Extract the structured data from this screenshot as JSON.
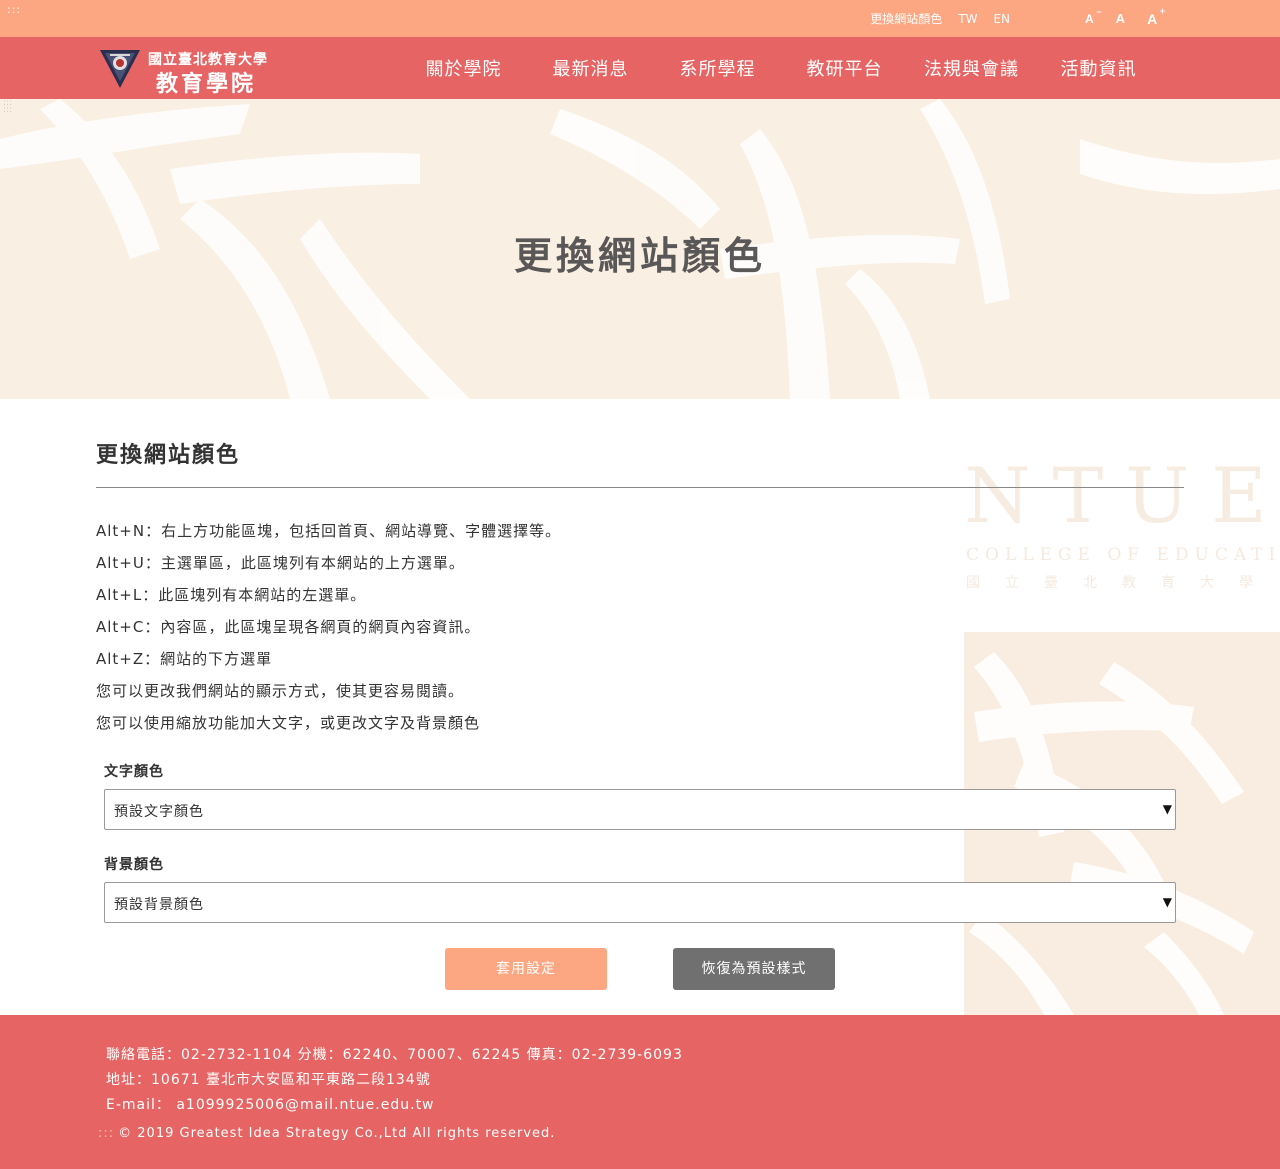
{
  "accesskey_top": ":::",
  "accesskey_side": ":::",
  "topbar": {
    "links": [
      "更換網站顏色",
      "TW",
      "EN"
    ],
    "font_sizes": [
      "A",
      "A",
      "A"
    ],
    "font_marks": [
      "−",
      "",
      "+"
    ]
  },
  "logo": {
    "line1": "國立臺北教育大學",
    "line2": "教育學院"
  },
  "nav": [
    "關於學院",
    "最新消息",
    "系所學程",
    "教研平台",
    "法規與會議",
    "活動資訊"
  ],
  "hero": {
    "title": "更換網站顏色"
  },
  "deco": {
    "big": "NTUE",
    "sub": "COLLEGE OF EDUCATION",
    "cn": "國立臺北教育大學"
  },
  "main": {
    "heading": "更換網站顏色",
    "descriptions": [
      "Alt+N：右上方功能區塊，包括回首頁、網站導覽、字體選擇等。",
      "Alt+U：主選單區，此區塊列有本網站的上方選單。",
      "Alt+L：此區塊列有本網站的左選單。",
      "Alt+C：內容區，此區塊呈現各網頁的網頁內容資訊。",
      "Alt+Z：網站的下方選單",
      "您可以更改我們網站的顯示方式，使其更容易閱讀。",
      "您可以使用縮放功能加大文字，或更改文字及背景顏色"
    ],
    "text_color": {
      "label": "文字顏色",
      "selected": "預設文字顏色"
    },
    "bg_color": {
      "label": "背景顏色",
      "selected": "預設背景顏色"
    },
    "apply_label": "套用設定",
    "reset_label": "恢復為預設樣式"
  },
  "footer": {
    "phone": "聯絡電話：02-2732-1104   分機：62240、70007、62245      傳真：02-2739-6093",
    "address": "地址：10671 臺北市大安區和平東路二段134號",
    "email": "E-mail：  a1099925006@mail.ntue.edu.tw",
    "copy_mark": ":::",
    "copyright": "© 2019 Greatest Idea Strategy Co.,Ltd All rights reserved."
  },
  "colors": {
    "topbar": "#fca682",
    "header": "#e66464",
    "footer": "#e66464",
    "hero_bg": "#f9efe3",
    "apply_btn": "#fca682",
    "reset_btn": "#707070"
  },
  "icons": [
    "emblem-icon",
    "dropdown-arrow-icon"
  ]
}
